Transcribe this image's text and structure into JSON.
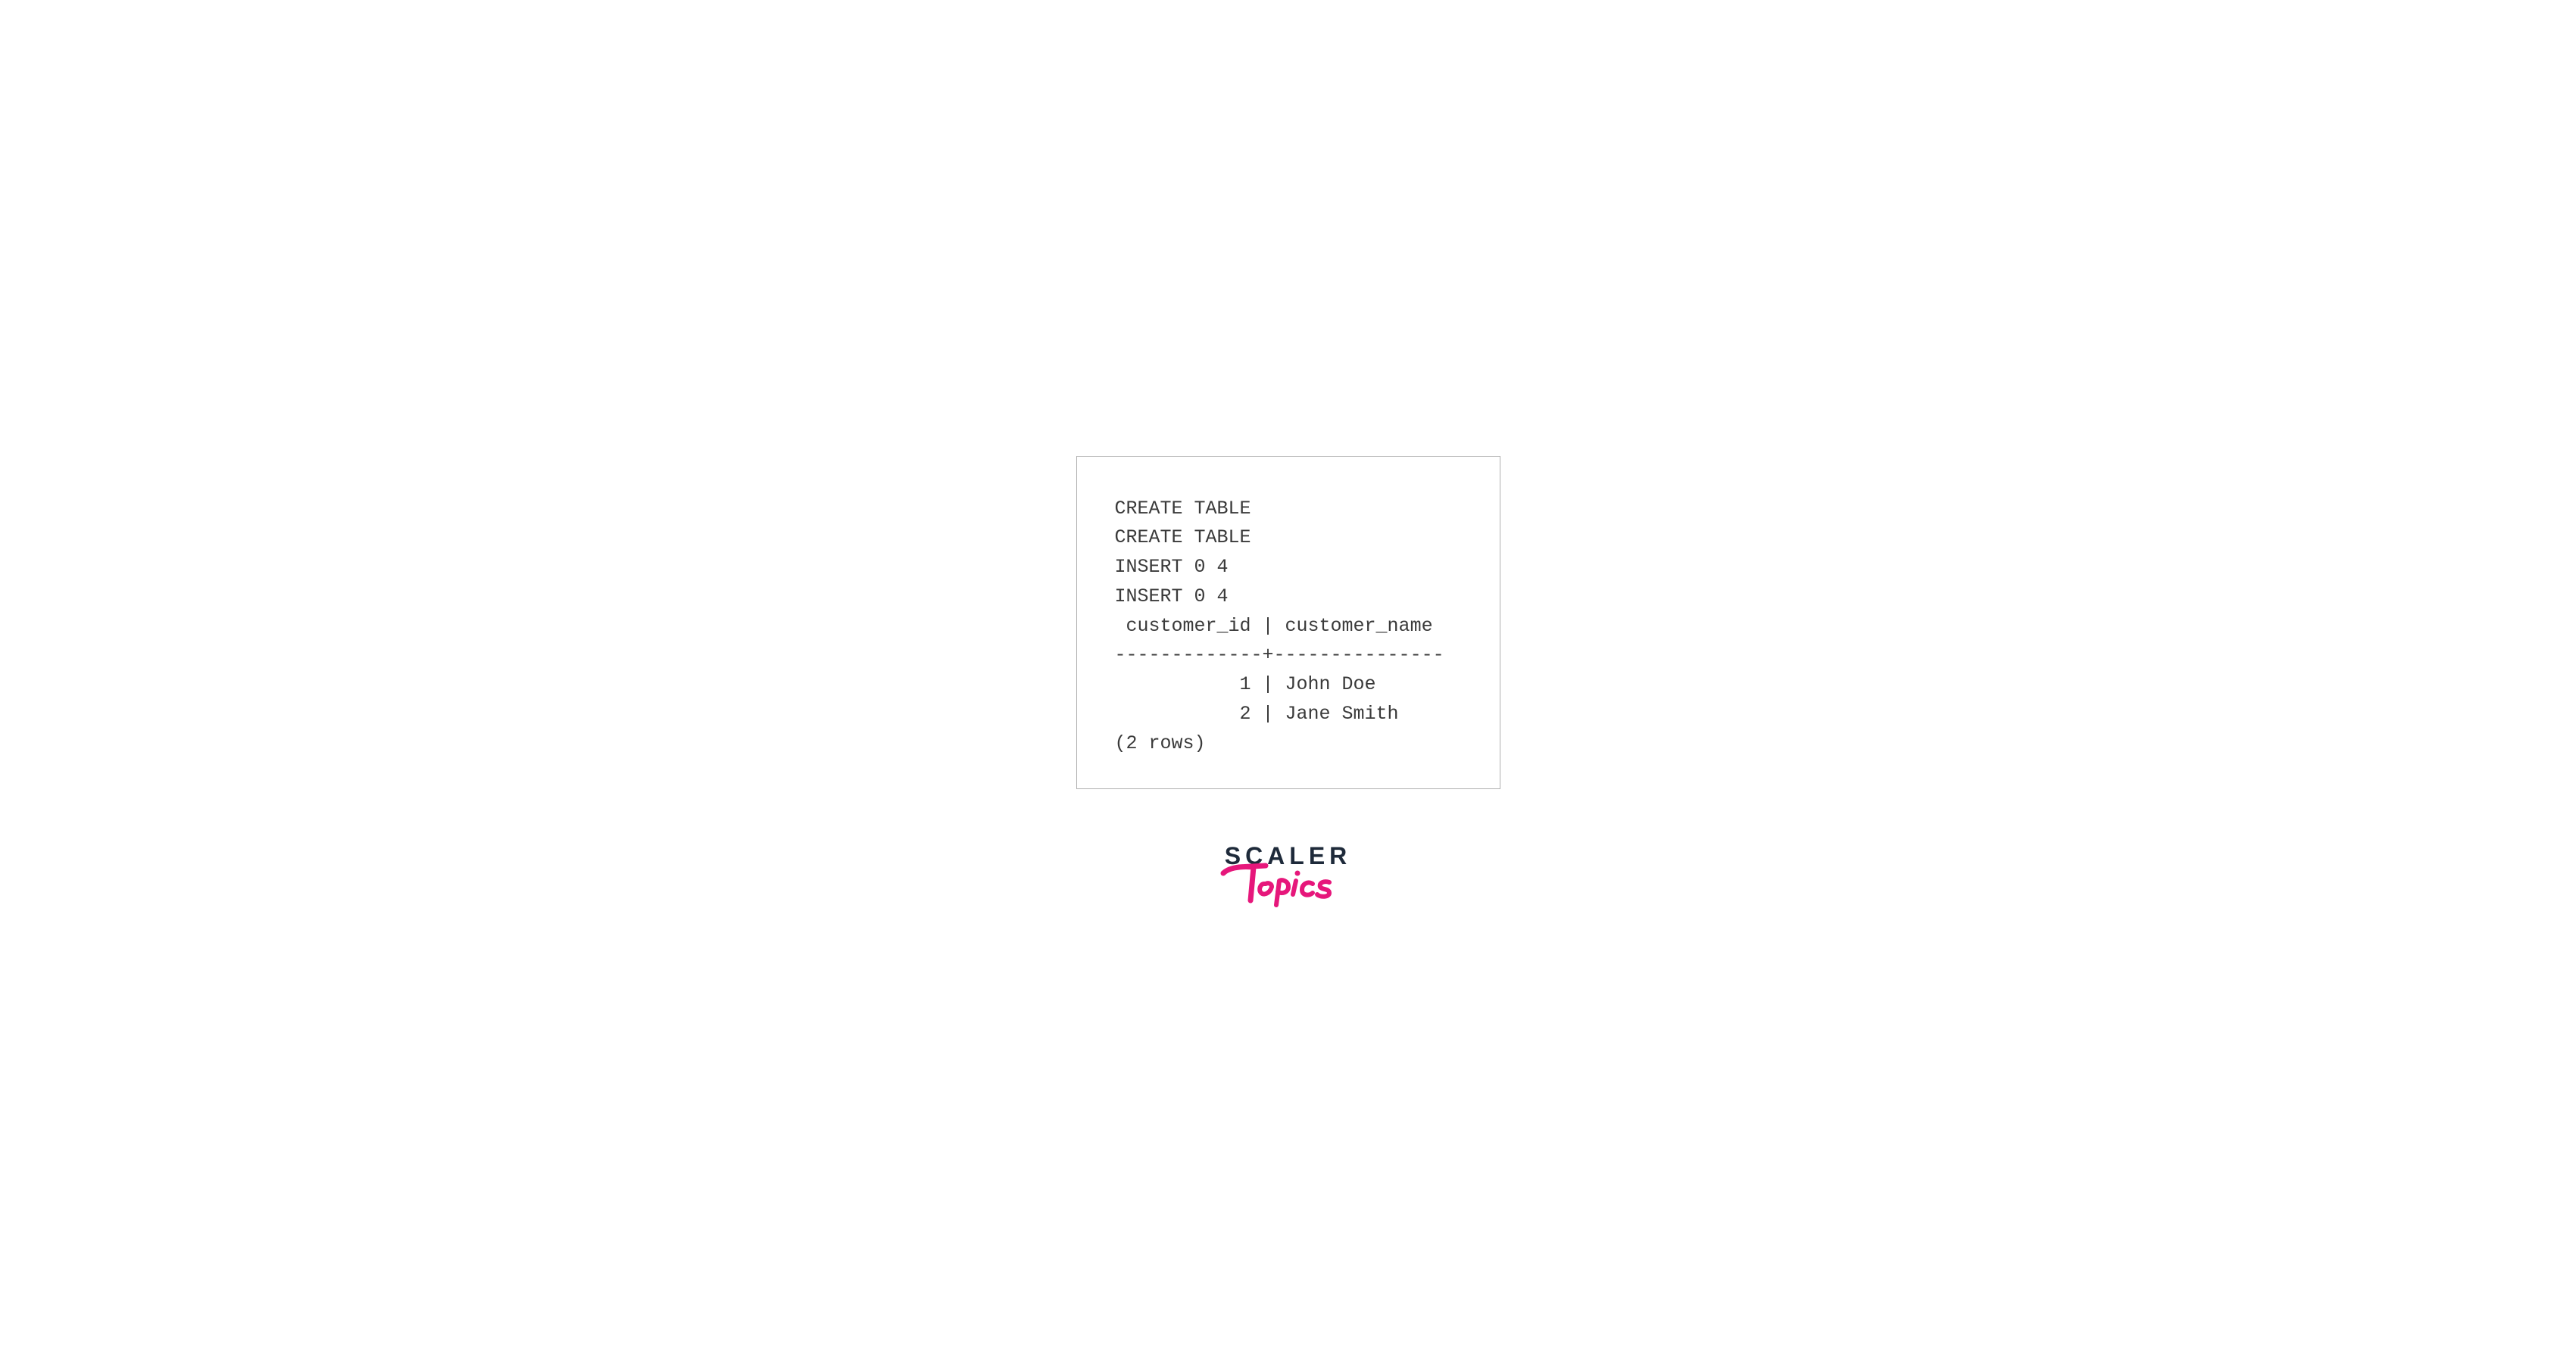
{
  "terminal": {
    "lines": [
      "CREATE TABLE",
      "CREATE TABLE",
      "INSERT 0 4",
      "INSERT 0 4",
      " customer_id | customer_name ",
      "-------------+---------------",
      "           1 | John Doe",
      "           2 | Jane Smith",
      "(2 rows)"
    ]
  },
  "logo": {
    "scaler": "SCALER",
    "topics": "Topics"
  },
  "colors": {
    "border": "#b0b0b0",
    "text": "#3a3a3a",
    "scaler": "#1e2a3a",
    "topics": "#e6177b"
  }
}
